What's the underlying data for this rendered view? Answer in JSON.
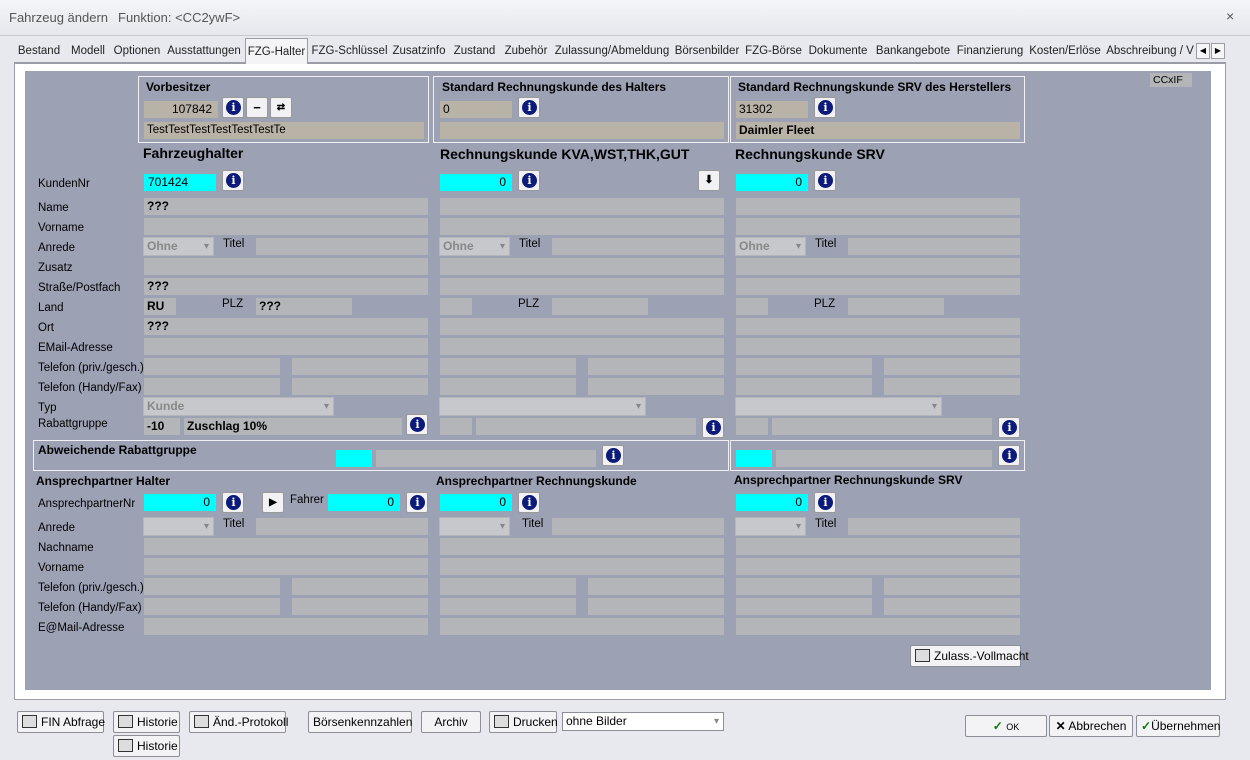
{
  "window": {
    "title": "Fahrzeug ändern",
    "function": "Funktion: <CC2ywF>",
    "close": "×"
  },
  "tabs": [
    "Bestand",
    "Modell",
    "Optionen",
    "Ausstattungen",
    "FZG-Halter",
    "FZG-Schlüssel",
    "Zusatzinfo",
    "Zustand",
    "Zubehör",
    "Zulassung/Abmeldung",
    "Börsenbilder",
    "FZG-Börse",
    "Dokumente",
    "Bankangebote",
    "Finanzierung",
    "Kosten/Erlöse",
    "Abschreibung / V"
  ],
  "active_tab": "FZG-Halter",
  "corner_code": "CCxIF",
  "vorbesitzer": {
    "title": "Vorbesitzer",
    "number": "107842",
    "name": "TestTestTestTestTestTestTe",
    "minus": "−"
  },
  "std_rk_halter": {
    "title": "Standard Rechnungskunde des Halters",
    "value": "0",
    "name": ""
  },
  "std_rk_srv": {
    "title": "Standard Rechnungskunde SRV des Herstellers",
    "value": "31302",
    "name": "Daimler Fleet"
  },
  "headings": {
    "halter": "Fahrzeughalter",
    "rk": "Rechnungskunde KVA,WST,THK,GUT",
    "srv": "Rechnungskunde SRV"
  },
  "labels": {
    "kundennr": "KundenNr",
    "name": "Name",
    "vorname": "Vorname",
    "anrede": "Anrede",
    "zusatz": "Zusatz",
    "strasse": "Straße/Postfach",
    "land": "Land",
    "ort": "Ort",
    "email": "EMail-Adresse",
    "telefon1": "Telefon (priv./gesch.)",
    "telefon2": "Telefon (Handy/Fax)",
    "typ": "Typ",
    "rabatt": "Rabattgruppe",
    "titel": "Titel",
    "plz": "PLZ"
  },
  "halter": {
    "kundennr": "701424",
    "name": "???",
    "anrede": "Ohne",
    "strasse": "???",
    "land": "RU",
    "plz": "???",
    "ort": "???",
    "typ": "Kunde",
    "rabatt_code": "-10",
    "rabatt_text": "Zuschlag 10%"
  },
  "rk": {
    "kundennr": "0",
    "anrede": "Ohne"
  },
  "srv": {
    "kundennr": "0",
    "anrede": "Ohne"
  },
  "abweichende": {
    "title": "Abweichende Rabattgruppe"
  },
  "ansprech": {
    "halter_title": "Ansprechpartner Halter",
    "rk_title": "Ansprechpartner Rechnungskunde",
    "srv_title": "Ansprechpartner Rechnungskunde SRV",
    "labels": {
      "nr": "AnsprechpartnerNr",
      "anrede": "Anrede",
      "nachname": "Nachname",
      "vorname": "Vorname",
      "telefon1": "Telefon (priv./gesch.)",
      "telefon2": "Telefon (Handy/Fax)",
      "email": "E@Mail-Adresse",
      "fahrer": "Fahrer"
    },
    "halter_nr": "0",
    "fahrer_nr": "0",
    "rk_nr": "0",
    "srv_nr": "0"
  },
  "zulass_btn": "Zulass.-Vollmacht",
  "bottom": {
    "fin": "FIN Abfrage",
    "historie": "Historie",
    "aend": "Änd.-Protokoll",
    "boersen": "Börsenkennzahlen",
    "archiv": "Archiv",
    "drucken": "Drucken",
    "bilder": "ohne Bilder",
    "historie2": "Historie",
    "ok": "OK",
    "abbrechen": "Abbrechen",
    "uebernehmen": "Übernehmen"
  }
}
